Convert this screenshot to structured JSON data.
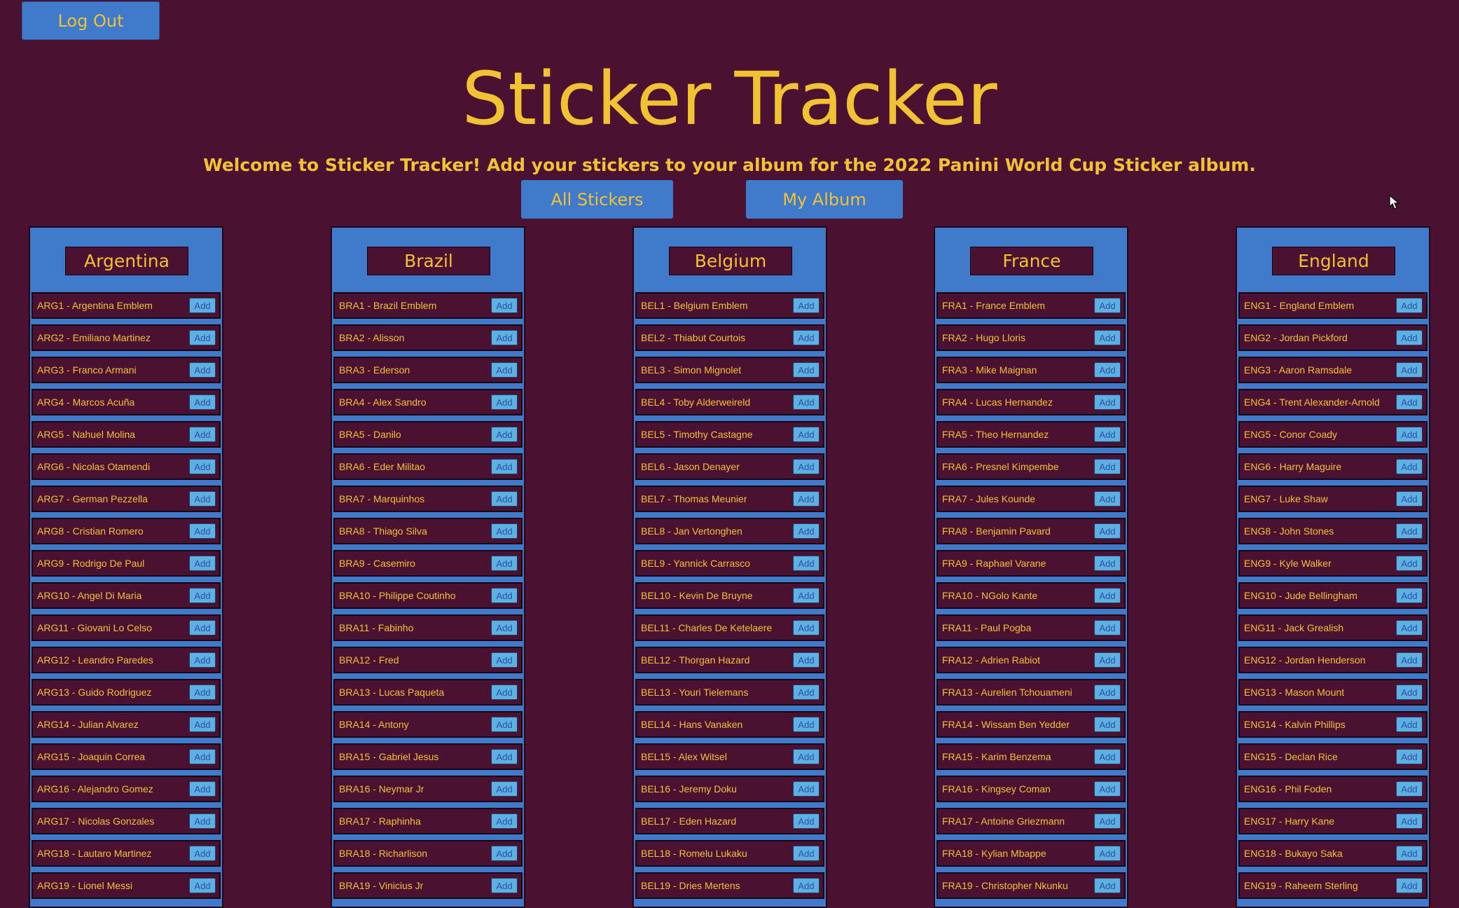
{
  "header": {
    "logout_label": "Log Out",
    "title": "Sticker Tracker",
    "welcome": "Welcome to Sticker Tracker! Add your stickers to your album for the 2022 Panini World Cup Sticker album."
  },
  "nav": {
    "all_stickers_label": "All Stickers",
    "my_album_label": "My Album"
  },
  "colors": {
    "background": "#4a1230",
    "accent_blue": "#3f7acb",
    "text_gold": "#f2c235",
    "add_button": "#5db0e3"
  },
  "teams": [
    {
      "name": "Argentina",
      "stickers": [
        {
          "label": "ARG1 - Argentina Emblem",
          "button": "Add"
        },
        {
          "label": "ARG2 - Emiliano Martinez",
          "button": "Add"
        },
        {
          "label": "ARG3 - Franco Armani",
          "button": "Add"
        },
        {
          "label": "ARG4 - Marcos Acuña",
          "button": "Add"
        },
        {
          "label": "ARG5 - Nahuel Molina",
          "button": "Add"
        },
        {
          "label": "ARG6 - Nicolas Otamendi",
          "button": "Add"
        },
        {
          "label": "ARG7 - German Pezzella",
          "button": "Add"
        },
        {
          "label": "ARG8 - Cristian Romero",
          "button": "Add"
        },
        {
          "label": "ARG9 - Rodrigo De Paul",
          "button": "Add"
        },
        {
          "label": "ARG10 - Angel Di Maria",
          "button": "Add"
        },
        {
          "label": "ARG11 - Giovani Lo Celso",
          "button": "Add"
        },
        {
          "label": "ARG12 - Leandro Paredes",
          "button": "Add"
        },
        {
          "label": "ARG13 - Guido Rodriguez",
          "button": "Add"
        },
        {
          "label": "ARG14 - Julian Alvarez",
          "button": "Add"
        },
        {
          "label": "ARG15 - Joaquin Correa",
          "button": "Add"
        },
        {
          "label": "ARG16 - Alejandro Gomez",
          "button": "Add"
        },
        {
          "label": "ARG17 - Nicolas Gonzales",
          "button": "Add"
        },
        {
          "label": "ARG18 - Lautaro Martinez",
          "button": "Add"
        },
        {
          "label": "ARG19 - Lionel Messi",
          "button": "Add"
        }
      ]
    },
    {
      "name": "Brazil",
      "stickers": [
        {
          "label": "BRA1 - Brazil Emblem",
          "button": "Add"
        },
        {
          "label": "BRA2 - Alisson",
          "button": "Add"
        },
        {
          "label": "BRA3 - Ederson",
          "button": "Add"
        },
        {
          "label": "BRA4 - Alex Sandro",
          "button": "Add"
        },
        {
          "label": "BRA5 - Danilo",
          "button": "Add"
        },
        {
          "label": "BRA6 - Eder Militao",
          "button": "Add"
        },
        {
          "label": "BRA7 - Marquinhos",
          "button": "Add"
        },
        {
          "label": "BRA8 - Thiago Silva",
          "button": "Add"
        },
        {
          "label": "BRA9 - Casemiro",
          "button": "Add"
        },
        {
          "label": "BRA10 - Philippe Coutinho",
          "button": "Add"
        },
        {
          "label": "BRA11 - Fabinho",
          "button": "Add"
        },
        {
          "label": "BRA12 - Fred",
          "button": "Add"
        },
        {
          "label": "BRA13 - Lucas Paqueta",
          "button": "Add"
        },
        {
          "label": "BRA14 - Antony",
          "button": "Add"
        },
        {
          "label": "BRA15 - Gabriel Jesus",
          "button": "Add"
        },
        {
          "label": "BRA16 - Neymar Jr",
          "button": "Add"
        },
        {
          "label": "BRA17 - Raphinha",
          "button": "Add"
        },
        {
          "label": "BRA18 - Richarlison",
          "button": "Add"
        },
        {
          "label": "BRA19 - Vinicius Jr",
          "button": "Add"
        }
      ]
    },
    {
      "name": "Belgium",
      "stickers": [
        {
          "label": "BEL1 - Belgium Emblem",
          "button": "Add"
        },
        {
          "label": "BEL2 - Thiabut Courtois",
          "button": "Add"
        },
        {
          "label": "BEL3 - Simon Mignolet",
          "button": "Add"
        },
        {
          "label": "BEL4 - Toby Alderweireld",
          "button": "Add"
        },
        {
          "label": "BEL5 - Timothy Castagne",
          "button": "Add"
        },
        {
          "label": "BEL6 - Jason Denayer",
          "button": "Add"
        },
        {
          "label": "BEL7 - Thomas Meunier",
          "button": "Add"
        },
        {
          "label": "BEL8 - Jan Vertonghen",
          "button": "Add"
        },
        {
          "label": "BEL9 - Yannick Carrasco",
          "button": "Add"
        },
        {
          "label": "BEL10 - Kevin De Bruyne",
          "button": "Add"
        },
        {
          "label": "BEL11 - Charles De Ketelaere",
          "button": "Add"
        },
        {
          "label": "BEL12 - Thorgan Hazard",
          "button": "Add"
        },
        {
          "label": "BEL13 - Youri Tielemans",
          "button": "Add"
        },
        {
          "label": "BEL14 - Hans Vanaken",
          "button": "Add"
        },
        {
          "label": "BEL15 - Alex Witsel",
          "button": "Add"
        },
        {
          "label": "BEL16 - Jeremy Doku",
          "button": "Add"
        },
        {
          "label": "BEL17 - Eden Hazard",
          "button": "Add"
        },
        {
          "label": "BEL18 - Romelu Lukaku",
          "button": "Add"
        },
        {
          "label": "BEL19 - Dries Mertens",
          "button": "Add"
        }
      ]
    },
    {
      "name": "France",
      "stickers": [
        {
          "label": "FRA1 - France Emblem",
          "button": "Add"
        },
        {
          "label": "FRA2 - Hugo Lloris",
          "button": "Add"
        },
        {
          "label": "FRA3 - Mike Maignan",
          "button": "Add"
        },
        {
          "label": "FRA4 - Lucas Hernandez",
          "button": "Add"
        },
        {
          "label": "FRA5 - Theo Hernandez",
          "button": "Add"
        },
        {
          "label": "FRA6 - Presnel Kimpembe",
          "button": "Add"
        },
        {
          "label": "FRA7 - Jules Kounde",
          "button": "Add"
        },
        {
          "label": "FRA8 - Benjamin Pavard",
          "button": "Add"
        },
        {
          "label": "FRA9 - Raphael Varane",
          "button": "Add"
        },
        {
          "label": "FRA10 - NGolo Kante",
          "button": "Add"
        },
        {
          "label": "FRA11 - Paul Pogba",
          "button": "Add"
        },
        {
          "label": "FRA12 - Adrien Rabiot",
          "button": "Add"
        },
        {
          "label": "FRA13 - Aurelien Tchouameni",
          "button": "Add"
        },
        {
          "label": "FRA14 - Wissam Ben Yedder",
          "button": "Add"
        },
        {
          "label": "FRA15 - Karim Benzema",
          "button": "Add"
        },
        {
          "label": "FRA16 - Kingsey Coman",
          "button": "Add"
        },
        {
          "label": "FRA17 - Antoine Griezmann",
          "button": "Add"
        },
        {
          "label": "FRA18 - Kylian Mbappe",
          "button": "Add"
        },
        {
          "label": "FRA19 - Christopher Nkunku",
          "button": "Add"
        }
      ]
    },
    {
      "name": "England",
      "stickers": [
        {
          "label": "ENG1 - England Emblem",
          "button": "Add"
        },
        {
          "label": "ENG2 - Jordan Pickford",
          "button": "Add"
        },
        {
          "label": "ENG3 - Aaron Ramsdale",
          "button": "Add"
        },
        {
          "label": "ENG4 - Trent Alexander-Arnold",
          "button": "Add"
        },
        {
          "label": "ENG5 - Conor Coady",
          "button": "Add"
        },
        {
          "label": "ENG6 - Harry Maguire",
          "button": "Add"
        },
        {
          "label": "ENG7 - Luke Shaw",
          "button": "Add"
        },
        {
          "label": "ENG8 - John Stones",
          "button": "Add"
        },
        {
          "label": "ENG9 - Kyle Walker",
          "button": "Add"
        },
        {
          "label": "ENG10 - Jude Bellingham",
          "button": "Add"
        },
        {
          "label": "ENG11 - Jack Grealish",
          "button": "Add"
        },
        {
          "label": "ENG12 - Jordan Henderson",
          "button": "Add"
        },
        {
          "label": "ENG13 - Mason Mount",
          "button": "Add"
        },
        {
          "label": "ENG14 - Kalvin Phillips",
          "button": "Add"
        },
        {
          "label": "ENG15 - Declan Rice",
          "button": "Add"
        },
        {
          "label": "ENG16 - Phil Foden",
          "button": "Add"
        },
        {
          "label": "ENG17 - Harry Kane",
          "button": "Add"
        },
        {
          "label": "ENG18 - Bukayo Saka",
          "button": "Add"
        },
        {
          "label": "ENG19 - Raheem Sterling",
          "button": "Add"
        }
      ]
    }
  ]
}
